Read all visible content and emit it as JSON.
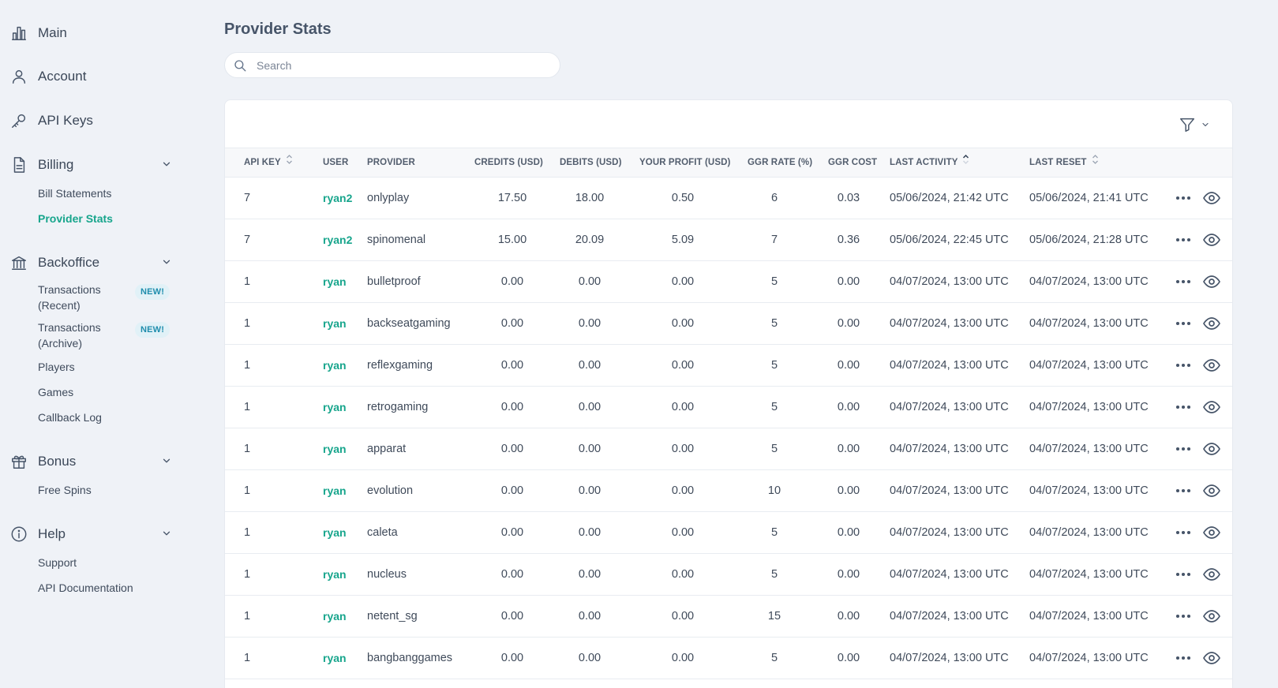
{
  "sidebar": {
    "main": {
      "label": "Main",
      "icon": "bar-chart-icon"
    },
    "account": {
      "label": "Account",
      "icon": "user-icon"
    },
    "api_keys": {
      "label": "API Keys",
      "icon": "key-icon"
    },
    "billing": {
      "label": "Billing",
      "icon": "document-icon",
      "items": [
        "Bill Statements",
        "Provider Stats"
      ]
    },
    "backoffice": {
      "label": "Backoffice",
      "icon": "bank-icon",
      "tx_recent_1": "Transactions",
      "tx_recent_2": "(Recent)",
      "tx_archive_1": "Transactions",
      "tx_archive_2": "(Archive)",
      "badge": "NEW!",
      "items": [
        "Players",
        "Games",
        "Callback Log"
      ]
    },
    "bonus": {
      "label": "Bonus",
      "icon": "gift-icon",
      "items": [
        "Free Spins"
      ]
    },
    "help": {
      "label": "Help",
      "icon": "info-icon",
      "items": [
        "Support",
        "API Documentation"
      ]
    }
  },
  "page": {
    "title": "Provider Stats",
    "search_placeholder": "Search"
  },
  "table": {
    "headers": {
      "api_key": "API KEY",
      "user": "USER",
      "provider": "PROVIDER",
      "credits": "CREDITS (USD)",
      "debits": "DEBITS (USD)",
      "profit": "YOUR PROFIT (USD)",
      "ggr_rate": "GGR RATE (%)",
      "ggr_cost": "GGR COST",
      "last_activity": "LAST ACTIVITY",
      "last_reset": "LAST RESET"
    },
    "rows": [
      {
        "api_key": "7",
        "user": "ryan2",
        "provider": "onlyplay",
        "credits": "17.50",
        "debits": "18.00",
        "profit": "0.50",
        "ggr_rate": "6",
        "ggr_cost": "0.03",
        "last_activity": "05/06/2024, 21:42 UTC",
        "last_reset": "05/06/2024, 21:41 UTC"
      },
      {
        "api_key": "7",
        "user": "ryan2",
        "provider": "spinomenal",
        "credits": "15.00",
        "debits": "20.09",
        "profit": "5.09",
        "ggr_rate": "7",
        "ggr_cost": "0.36",
        "last_activity": "05/06/2024, 22:45 UTC",
        "last_reset": "05/06/2024, 21:28 UTC"
      },
      {
        "api_key": "1",
        "user": "ryan",
        "provider": "bulletproof",
        "credits": "0.00",
        "debits": "0.00",
        "profit": "0.00",
        "ggr_rate": "5",
        "ggr_cost": "0.00",
        "last_activity": "04/07/2024, 13:00 UTC",
        "last_reset": "04/07/2024, 13:00 UTC"
      },
      {
        "api_key": "1",
        "user": "ryan",
        "provider": "backseatgaming",
        "credits": "0.00",
        "debits": "0.00",
        "profit": "0.00",
        "ggr_rate": "5",
        "ggr_cost": "0.00",
        "last_activity": "04/07/2024, 13:00 UTC",
        "last_reset": "04/07/2024, 13:00 UTC"
      },
      {
        "api_key": "1",
        "user": "ryan",
        "provider": "reflexgaming",
        "credits": "0.00",
        "debits": "0.00",
        "profit": "0.00",
        "ggr_rate": "5",
        "ggr_cost": "0.00",
        "last_activity": "04/07/2024, 13:00 UTC",
        "last_reset": "04/07/2024, 13:00 UTC"
      },
      {
        "api_key": "1",
        "user": "ryan",
        "provider": "retrogaming",
        "credits": "0.00",
        "debits": "0.00",
        "profit": "0.00",
        "ggr_rate": "5",
        "ggr_cost": "0.00",
        "last_activity": "04/07/2024, 13:00 UTC",
        "last_reset": "04/07/2024, 13:00 UTC"
      },
      {
        "api_key": "1",
        "user": "ryan",
        "provider": "apparat",
        "credits": "0.00",
        "debits": "0.00",
        "profit": "0.00",
        "ggr_rate": "5",
        "ggr_cost": "0.00",
        "last_activity": "04/07/2024, 13:00 UTC",
        "last_reset": "04/07/2024, 13:00 UTC"
      },
      {
        "api_key": "1",
        "user": "ryan",
        "provider": "evolution",
        "credits": "0.00",
        "debits": "0.00",
        "profit": "0.00",
        "ggr_rate": "10",
        "ggr_cost": "0.00",
        "last_activity": "04/07/2024, 13:00 UTC",
        "last_reset": "04/07/2024, 13:00 UTC"
      },
      {
        "api_key": "1",
        "user": "ryan",
        "provider": "caleta",
        "credits": "0.00",
        "debits": "0.00",
        "profit": "0.00",
        "ggr_rate": "5",
        "ggr_cost": "0.00",
        "last_activity": "04/07/2024, 13:00 UTC",
        "last_reset": "04/07/2024, 13:00 UTC"
      },
      {
        "api_key": "1",
        "user": "ryan",
        "provider": "nucleus",
        "credits": "0.00",
        "debits": "0.00",
        "profit": "0.00",
        "ggr_rate": "5",
        "ggr_cost": "0.00",
        "last_activity": "04/07/2024, 13:00 UTC",
        "last_reset": "04/07/2024, 13:00 UTC"
      },
      {
        "api_key": "1",
        "user": "ryan",
        "provider": "netent_sg",
        "credits": "0.00",
        "debits": "0.00",
        "profit": "0.00",
        "ggr_rate": "15",
        "ggr_cost": "0.00",
        "last_activity": "04/07/2024, 13:00 UTC",
        "last_reset": "04/07/2024, 13:00 UTC"
      },
      {
        "api_key": "1",
        "user": "ryan",
        "provider": "bangbanggames",
        "credits": "0.00",
        "debits": "0.00",
        "profit": "0.00",
        "ggr_rate": "5",
        "ggr_cost": "0.00",
        "last_activity": "04/07/2024, 13:00 UTC",
        "last_reset": "04/07/2024, 13:00 UTC"
      }
    ],
    "row_actions": [
      "more-options-icon",
      "eye-icon"
    ]
  },
  "colors": {
    "accent": "#17a58c",
    "background": "#eff2f7",
    "badge_text": "#1f8dad"
  }
}
